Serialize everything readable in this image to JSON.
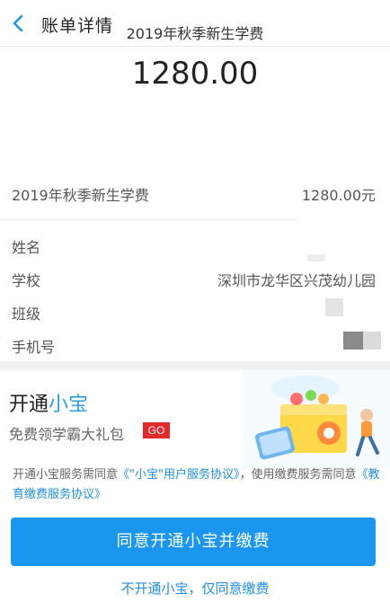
{
  "header": {
    "title": "账单详情",
    "back_icon": "chevron-left-icon"
  },
  "summary": {
    "bill_name": "2019年秋季新生学费",
    "amount": "1280.00"
  },
  "line_item": {
    "label": "2019年秋季新生学费",
    "value": "1280.00元"
  },
  "details": [
    {
      "label": "姓名",
      "value": ""
    },
    {
      "label": "学校",
      "value": "深圳市龙华区兴茂幼儿园"
    },
    {
      "label": "班级",
      "value": ""
    },
    {
      "label": "手机号",
      "value": ""
    }
  ],
  "promo": {
    "title_prefix": "开通",
    "title_highlight": "小宝",
    "subtitle": "免费领学霸大礼包",
    "badge": "GO",
    "agreement_text_1": "开通小宝服务需同意",
    "agreement_link_1": "《\"小宝\"用户服务协议》",
    "agreement_text_2": "，使用缴费服务需同意",
    "agreement_link_2": "《教育缴费服务协议》",
    "primary_button": "同意开通小宝并缴费",
    "secondary_link": "不开通小宝，仅同意缴费"
  },
  "colors": {
    "accent": "#1a96f0",
    "link": "#1f8fe8",
    "badge": "#e4292a",
    "highlight": "#2b9de9"
  }
}
